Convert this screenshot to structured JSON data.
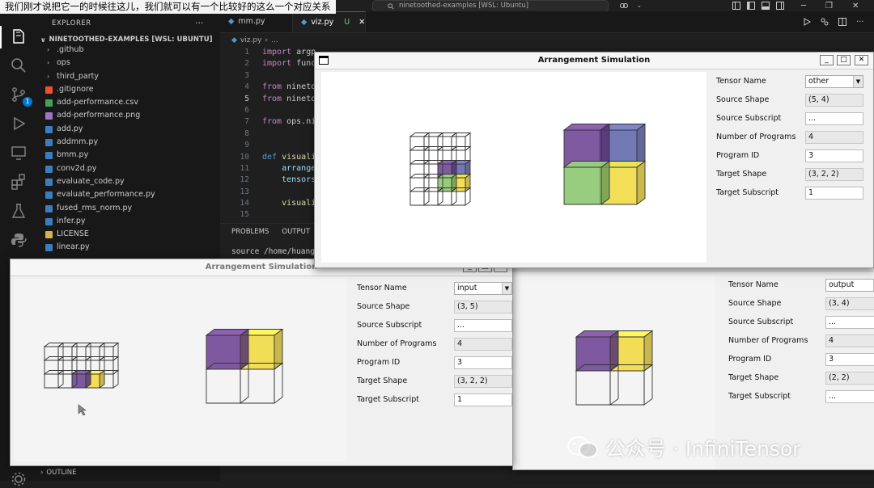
{
  "caption_overlay": "我们刚才说把它一的时候往这儿，我们就可以有一个比较好的这么一个对应关系",
  "command_center": "ninetoothed-examples [WSL: Ubuntu]",
  "sidebar": {
    "title": "EXPLORER",
    "more": "···",
    "section": "NINETOOTHED-EXAMPLES [WSL: UBUNTU]",
    "items": [
      {
        "label": ".github",
        "kind": "folder"
      },
      {
        "label": "ops",
        "kind": "folder"
      },
      {
        "label": "third_party",
        "kind": "folder"
      },
      {
        "label": ".gitignore",
        "kind": "git"
      },
      {
        "label": "add-performance.csv",
        "kind": "csv"
      },
      {
        "label": "add-performance.png",
        "kind": "png"
      },
      {
        "label": "add.py",
        "kind": "py"
      },
      {
        "label": "addmm.py",
        "kind": "py"
      },
      {
        "label": "bmm.py",
        "kind": "py"
      },
      {
        "label": "conv2d.py",
        "kind": "py"
      },
      {
        "label": "evaluate_code.py",
        "kind": "py"
      },
      {
        "label": "evaluate_performance.py",
        "kind": "py"
      },
      {
        "label": "fused_rms_norm.py",
        "kind": "py"
      },
      {
        "label": "infer.py",
        "kind": "py"
      },
      {
        "label": "LICENSE",
        "kind": "license"
      },
      {
        "label": "linear.py",
        "kind": "py"
      }
    ],
    "outline": "OUTLINE",
    "badge": "1"
  },
  "editor": {
    "tabs": [
      {
        "label": "mm.py",
        "modified": ""
      },
      {
        "label": "viz.py",
        "modified": "U"
      }
    ],
    "breadcrumb": [
      "viz.py",
      "..."
    ],
    "line_numbers": [
      "1",
      "2",
      "3",
      "4",
      "5",
      "6",
      "7",
      "8",
      "9",
      "10",
      "11",
      "12",
      "13",
      "14",
      "15"
    ],
    "code": [
      [
        {
          "c": "kw",
          "t": "import "
        },
        {
          "c": "plain",
          "t": "argp"
        }
      ],
      [
        {
          "c": "kw",
          "t": "import "
        },
        {
          "c": "plain",
          "t": "func"
        }
      ],
      [],
      [
        {
          "c": "kw",
          "t": "from "
        },
        {
          "c": "plain",
          "t": "nineto"
        }
      ],
      [
        {
          "c": "kw",
          "t": "from "
        },
        {
          "c": "plain",
          "t": "nineto"
        }
      ],
      [],
      [
        {
          "c": "kw",
          "t": "from "
        },
        {
          "c": "plain",
          "t": "ops.ni"
        }
      ],
      [],
      [],
      [
        {
          "c": "kw2",
          "t": "def "
        },
        {
          "c": "fn",
          "t": "visuali"
        }
      ],
      [
        {
          "c": "plain",
          "t": "    "
        },
        {
          "c": "id",
          "t": "arrange"
        }
      ],
      [
        {
          "c": "plain",
          "t": "    "
        },
        {
          "c": "id",
          "t": "tensors"
        }
      ],
      [],
      [
        {
          "c": "plain",
          "t": "    "
        },
        {
          "c": "fn",
          "t": "visuali"
        }
      ],
      []
    ],
    "panel_tabs": [
      "PROBLEMS",
      "OUTPUT"
    ],
    "terminal": "source /home/huang/"
  },
  "sims": [
    {
      "title": "Arrangement Simulation",
      "fields": {
        "tensor_name_label": "Tensor Name",
        "tensor_name": "other",
        "source_shape_label": "Source Shape",
        "source_shape": "(5, 4)",
        "source_subscript_label": "Source Subscript",
        "source_subscript": "...",
        "num_programs_label": "Number of Programs",
        "num_programs": "4",
        "program_id_label": "Program ID",
        "program_id": "3",
        "target_shape_label": "Target Shape",
        "target_shape": "(3, 2, 2)",
        "target_subscript_label": "Target Subscript",
        "target_subscript": "1"
      }
    },
    {
      "title": "Arrangement Simulation",
      "fields": {
        "tensor_name_label": "Tensor Name",
        "tensor_name": "input",
        "source_shape_label": "Source Shape",
        "source_shape": "(3, 5)",
        "source_subscript_label": "Source Subscript",
        "source_subscript": "...",
        "num_programs_label": "Number of Programs",
        "num_programs": "4",
        "program_id_label": "Program ID",
        "program_id": "3",
        "target_shape_label": "Target Shape",
        "target_shape": "(3, 2, 2)",
        "target_subscript_label": "Target Subscript",
        "target_subscript": "1"
      }
    },
    {
      "title": "",
      "fields": {
        "tensor_name_label": "Tensor Name",
        "tensor_name": "output",
        "source_shape_label": "Source Shape",
        "source_shape": "(3, 4)",
        "source_subscript_label": "Source Subscript",
        "source_subscript": "...",
        "num_programs_label": "Number of Programs",
        "num_programs": "4",
        "program_id_label": "Program ID",
        "program_id": "3",
        "target_shape_label": "Target Shape",
        "target_shape": "(2, 2)",
        "target_subscript_label": "Target Subscript",
        "target_subscript": "..."
      }
    }
  ],
  "watermark": "公众号 · InfiniTensor",
  "colors": {
    "purple": "#6a3d8f",
    "blue": "#5b62a8",
    "green": "#86c46a",
    "yellow": "#f0d83a"
  }
}
